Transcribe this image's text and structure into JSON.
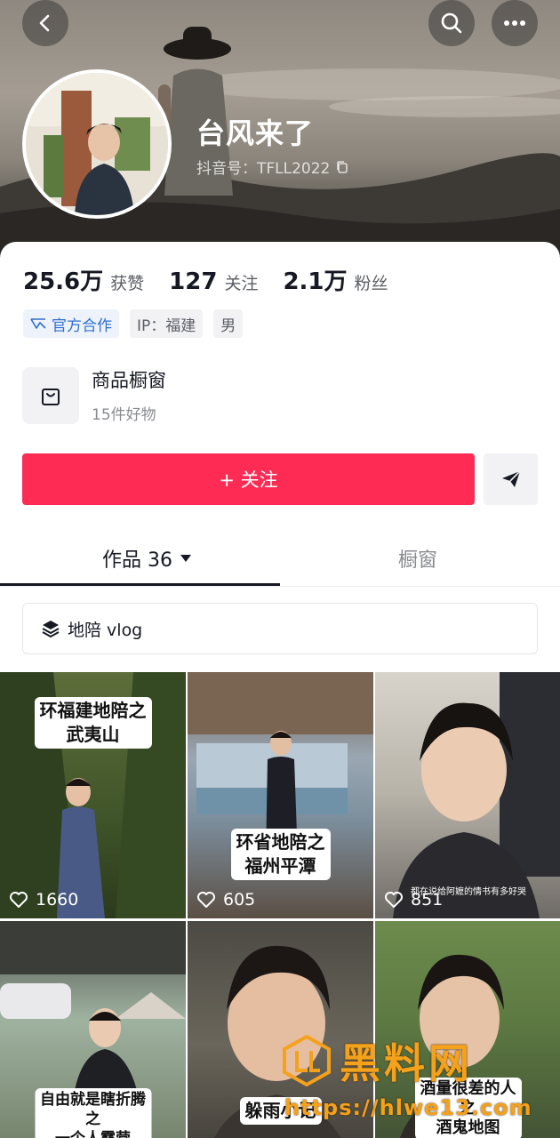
{
  "header": {
    "nickname": "台风来了",
    "douyin_id": "抖音号：TFLL2022",
    "back_icon": "back-arrow-icon",
    "search_icon": "search-icon",
    "more_icon": "more-dots-icon"
  },
  "stats": [
    {
      "num": "25.6万",
      "label": "获赞"
    },
    {
      "num": "127",
      "label": "关注"
    },
    {
      "num": "2.1万",
      "label": "粉丝"
    }
  ],
  "tags": {
    "official": "官方合作",
    "ip": "IP：福建",
    "gender": "男"
  },
  "shop": {
    "title": "商品橱窗",
    "subtitle": "15件好物"
  },
  "follow_label": "+ 关注",
  "tabs": {
    "works": "作品 36",
    "showcase": "橱窗"
  },
  "collection_label": "地陪 vlog",
  "videos": [
    {
      "caption_line1": "环福建地陪之",
      "caption_line2": "武夷山",
      "likes": "1660"
    },
    {
      "caption_line1": "环省地陪之",
      "caption_line2": "福州平潭",
      "likes": "605"
    },
    {
      "caption_line1": "",
      "caption_line2": "",
      "subtitle": "都在说给阿嬷的情书有多好哭",
      "likes": "851"
    },
    {
      "caption_line1": "自由就是瞎折腾",
      "caption_line2": "之",
      "caption_line3": "一个人露营"
    },
    {
      "caption_line1": "躲雨小记"
    },
    {
      "caption_line1": "酒量很差的人",
      "caption_line2": "之",
      "caption_line3": "酒鬼地图"
    }
  ],
  "watermark": {
    "text": "黑料网",
    "url": "https://hlwe13.com"
  },
  "colors": {
    "follow": "#fe2c55",
    "official_tag": "#2f6fcf",
    "watermark": "#f4a11c"
  }
}
